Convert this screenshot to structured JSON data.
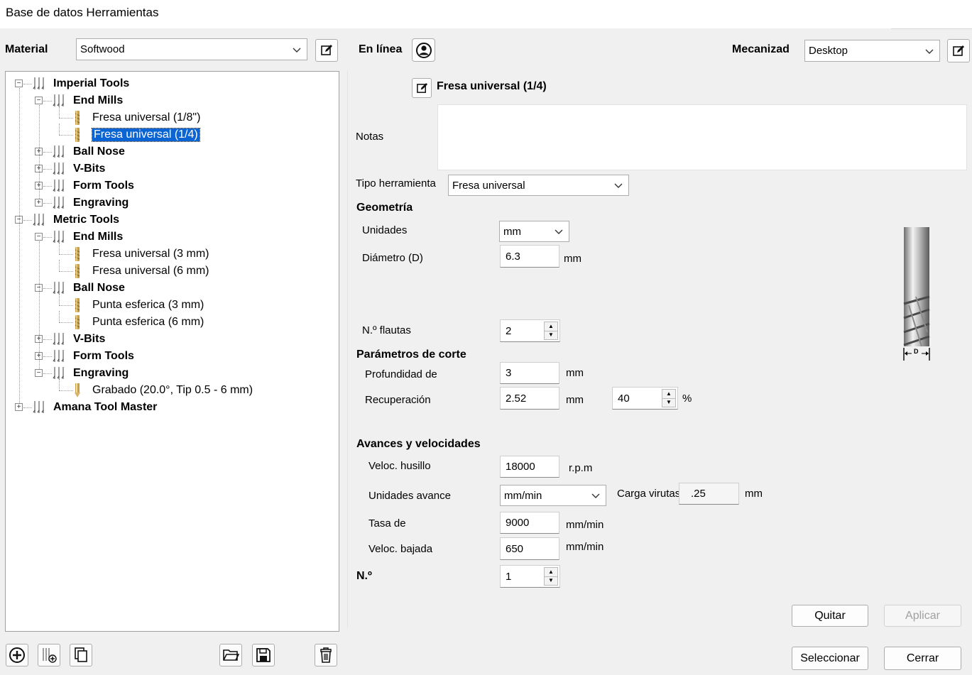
{
  "window": {
    "title": "Base de datos Herramientas"
  },
  "header": {
    "material_label": "Material",
    "material_value": "Softwood",
    "online_label": "En línea",
    "machine_label": "Mecanizad",
    "machine_value": "Desktop"
  },
  "tree": {
    "items": [
      {
        "label": "Imperial Tools",
        "level": 0,
        "type": "group",
        "expanded": true
      },
      {
        "label": "End Mills",
        "level": 1,
        "type": "group",
        "expanded": true
      },
      {
        "label": "Fresa universal (1/8\")",
        "level": 2,
        "type": "tool"
      },
      {
        "label": "Fresa universal (1/4)",
        "level": 2,
        "type": "tool",
        "selected": true
      },
      {
        "label": "Ball Nose",
        "level": 1,
        "type": "group",
        "expanded": false
      },
      {
        "label": "V-Bits",
        "level": 1,
        "type": "group",
        "expanded": false
      },
      {
        "label": "Form Tools",
        "level": 1,
        "type": "group",
        "expanded": false
      },
      {
        "label": "Engraving",
        "level": 1,
        "type": "group",
        "expanded": false
      },
      {
        "label": "Metric Tools",
        "level": 0,
        "type": "group",
        "expanded": true
      },
      {
        "label": "End Mills",
        "level": 1,
        "type": "group",
        "expanded": true
      },
      {
        "label": "Fresa universal (3 mm)",
        "level": 2,
        "type": "tool"
      },
      {
        "label": "Fresa universal (6 mm)",
        "level": 2,
        "type": "tool"
      },
      {
        "label": "Ball Nose",
        "level": 1,
        "type": "group",
        "expanded": true
      },
      {
        "label": "Punta esferica (3 mm)",
        "level": 2,
        "type": "tool"
      },
      {
        "label": "Punta esferica (6 mm)",
        "level": 2,
        "type": "tool"
      },
      {
        "label": "V-Bits",
        "level": 1,
        "type": "group",
        "expanded": false
      },
      {
        "label": "Form Tools",
        "level": 1,
        "type": "group",
        "expanded": false
      },
      {
        "label": "Engraving",
        "level": 1,
        "type": "group",
        "expanded": true
      },
      {
        "label": "Grabado (20.0°, Tip 0.5 - 6 mm)",
        "level": 2,
        "type": "tool-engrave"
      },
      {
        "label": "Amana Tool Master",
        "level": 0,
        "type": "group",
        "expanded": false
      }
    ]
  },
  "tool": {
    "name": "Fresa universal (1/4)",
    "notes_label": "Notas",
    "notes_value": "",
    "type_label": "Tipo herramienta",
    "type_value": "Fresa universal"
  },
  "geometry": {
    "heading": "Geometría",
    "units_label": "Unidades",
    "units_value": "mm",
    "diameter_label": "Diámetro (D)",
    "diameter_value": "6.3",
    "diameter_unit": "mm",
    "flutes_label": "N.º flautas",
    "flutes_value": "2",
    "diagram_label": "D"
  },
  "cutting": {
    "heading": "Parámetros de corte",
    "depth_label": "Profundidad de",
    "depth_value": "3",
    "depth_unit": "mm",
    "stepover_label": "Recuperación",
    "stepover_value": "2.52",
    "stepover_unit": "mm",
    "stepover_percent": "40",
    "percent_sign": "%"
  },
  "feeds": {
    "heading": "Avances y velocidades",
    "spindle_label": "Veloc. husillo",
    "spindle_value": "18000",
    "spindle_unit": "r.p.m",
    "feed_units_label": "Unidades avance",
    "feed_units_value": "mm/min",
    "chip_load_label": "Carga virutas",
    "chip_load_value": ".25",
    "chip_load_unit": "mm",
    "feed_rate_label": "Tasa de",
    "feed_rate_value": "9000",
    "feed_rate_unit": "mm/min",
    "plunge_label": "Veloc. bajada",
    "plunge_value": "650",
    "plunge_unit": "mm/min"
  },
  "tool_number": {
    "label": "N.º",
    "value": "1"
  },
  "buttons": {
    "remove": "Quitar",
    "apply": "Aplicar",
    "select": "Seleccionar",
    "close": "Cerrar"
  },
  "icons": {
    "edit": "edit-icon",
    "online": "user-circle-icon",
    "add": "add-circle-icon",
    "add_group": "add-group-icon",
    "copy": "copy-icon",
    "open": "folder-open-icon",
    "save": "save-icon",
    "delete": "trash-icon"
  }
}
